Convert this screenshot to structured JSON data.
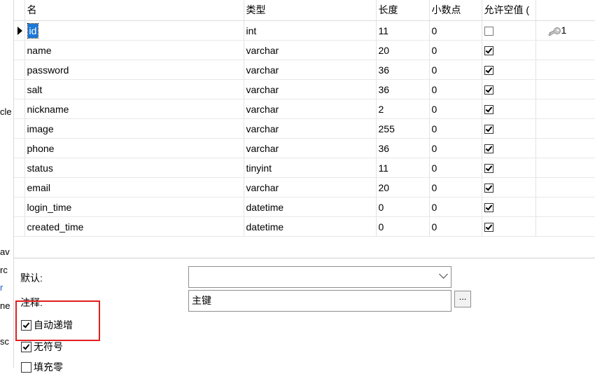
{
  "columns": [
    "名",
    "类型",
    "长度",
    "小数点",
    "允许空值 ("
  ],
  "rows": [
    {
      "name": "id",
      "type": "int",
      "length": "11",
      "decimal": "0",
      "nullable": false,
      "key": "1"
    },
    {
      "name": "name",
      "type": "varchar",
      "length": "20",
      "decimal": "0",
      "nullable": true,
      "key": ""
    },
    {
      "name": "password",
      "type": "varchar",
      "length": "36",
      "decimal": "0",
      "nullable": true,
      "key": ""
    },
    {
      "name": "salt",
      "type": "varchar",
      "length": "36",
      "decimal": "0",
      "nullable": true,
      "key": ""
    },
    {
      "name": "nickname",
      "type": "varchar",
      "length": "2",
      "decimal": "0",
      "nullable": true,
      "key": ""
    },
    {
      "name": "image",
      "type": "varchar",
      "length": "255",
      "decimal": "0",
      "nullable": true,
      "key": ""
    },
    {
      "name": "phone",
      "type": "varchar",
      "length": "36",
      "decimal": "0",
      "nullable": true,
      "key": ""
    },
    {
      "name": "status",
      "type": "tinyint",
      "length": "11",
      "decimal": "0",
      "nullable": true,
      "key": ""
    },
    {
      "name": "email",
      "type": "varchar",
      "length": "20",
      "decimal": "0",
      "nullable": true,
      "key": ""
    },
    {
      "name": "login_time",
      "type": "datetime",
      "length": "0",
      "decimal": "0",
      "nullable": true,
      "key": ""
    },
    {
      "name": "created_time",
      "type": "datetime",
      "length": "0",
      "decimal": "0",
      "nullable": true,
      "key": ""
    }
  ],
  "selected_row": 0,
  "left_strip": [
    "cle",
    "av",
    "rc",
    "r",
    "ne",
    "sc"
  ],
  "props": {
    "default_label": "默认:",
    "default_value": "",
    "comment_label": "注释:",
    "comment_value": "主键",
    "ellipsis": "...",
    "auto_increment_label": "自动递增",
    "auto_increment": true,
    "unsigned_label": "无符号",
    "unsigned": true,
    "zerofill_label": "填充零",
    "zerofill": false
  },
  "colors": {
    "selection": "#1a78d7",
    "highlight_box": "#e02020"
  },
  "icons": {
    "key": "key-icon",
    "row_pointer": "row-pointer-icon"
  }
}
